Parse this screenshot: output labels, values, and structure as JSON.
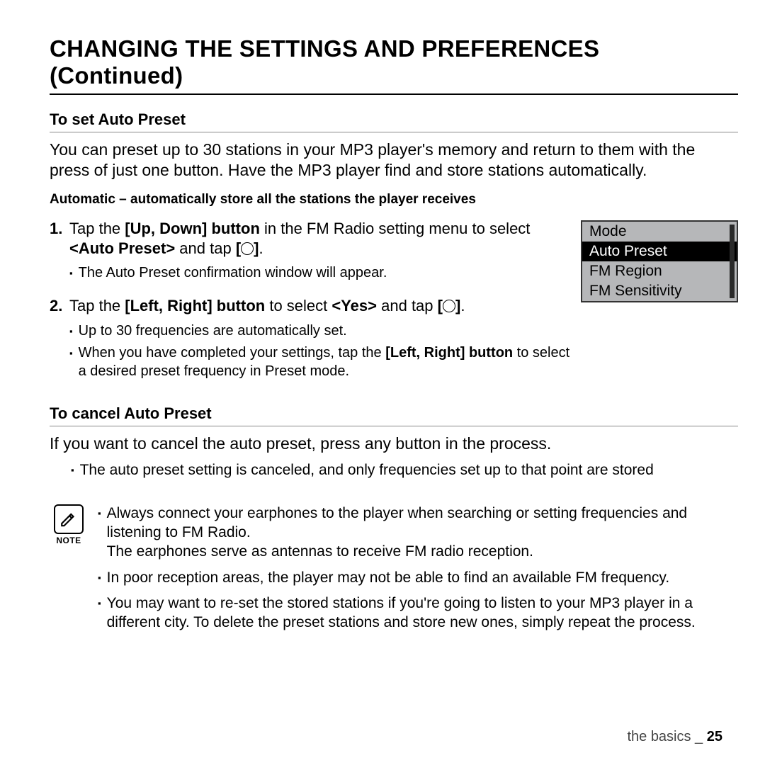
{
  "title": "CHANGING THE SETTINGS AND PREFERENCES (Continued)",
  "section1": {
    "heading": "To set Auto Preset",
    "intro": "You can preset up to 30 stations in your MP3 player's memory and return to them with the press of just one button. Have the MP3 player find and store stations automatically.",
    "automatic_line": "Automatic – automatically store all the stations the player receives",
    "step1_a": "Tap the ",
    "step1_b": "[Up, Down] button",
    "step1_c": " in the FM Radio setting menu to select ",
    "step1_d": "<Auto Preset>",
    "step1_e": " and tap ",
    "step1_f": ".",
    "step1_sub1": "The Auto Preset confirmation window will appear.",
    "step2_a": "Tap the ",
    "step2_b": "[Left, Right] button",
    "step2_c": " to select ",
    "step2_d": "<Yes>",
    "step2_e": " and tap ",
    "step2_f": ".",
    "step2_sub1": "Up to 30 frequencies are automatically set.",
    "step2_sub2_a": "When you have completed your settings, tap the ",
    "step2_sub2_b": "[Left, Right] button",
    "step2_sub2_c": " to select a desired preset frequency in Preset mode."
  },
  "menu": {
    "items": [
      "Mode",
      "Auto Preset",
      "FM Region",
      "FM Sensitivity"
    ],
    "selected_index": 1
  },
  "section2": {
    "heading": "To cancel Auto Preset",
    "intro": "If you want to cancel the auto preset, press any button in the process.",
    "sub1": "The auto preset setting is canceled, and only frequencies set up to that point are stored"
  },
  "note": {
    "label": "NOTE",
    "item1_a": "Always connect your earphones to the player when searching or setting frequencies and listening to FM Radio.",
    "item1_b": "The earphones serve as antennas to receive FM radio reception.",
    "item2": "In poor reception areas, the player may not be able to find an available FM frequency.",
    "item3": "You may want to re-set the stored stations if you're going to listen to your MP3 player in a different city. To delete the preset stations and store new ones, simply repeat the process."
  },
  "footer": {
    "section": "the basics _ ",
    "page": "25"
  }
}
